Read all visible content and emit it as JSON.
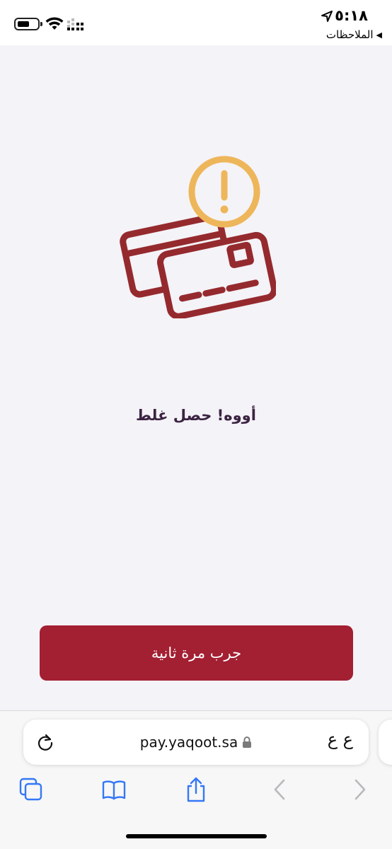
{
  "status_bar": {
    "time": "٥:١٨",
    "back_app": "الملاحظات",
    "back_arrow": "◀"
  },
  "main": {
    "error_message": "أووه! حصل غلط",
    "retry_button": "جرب مرة ثانية"
  },
  "browser": {
    "url": "pay.yaqoot.sa",
    "text_size_label": "ع ع"
  },
  "colors": {
    "accent": "#a31f32",
    "card_stroke": "#952a2e",
    "warning": "#eeb65a",
    "title": "#3b2342",
    "ios_blue": "#3478f6"
  },
  "icons": {
    "status": [
      "battery-icon",
      "wifi-icon",
      "cellular-signal-icon",
      "location-arrow-icon"
    ],
    "illustration": "credit-card-error-icon",
    "browser": [
      "reload-icon",
      "lock-icon",
      "tabs-icon",
      "bookmarks-icon",
      "share-icon",
      "back-icon",
      "forward-icon"
    ]
  }
}
